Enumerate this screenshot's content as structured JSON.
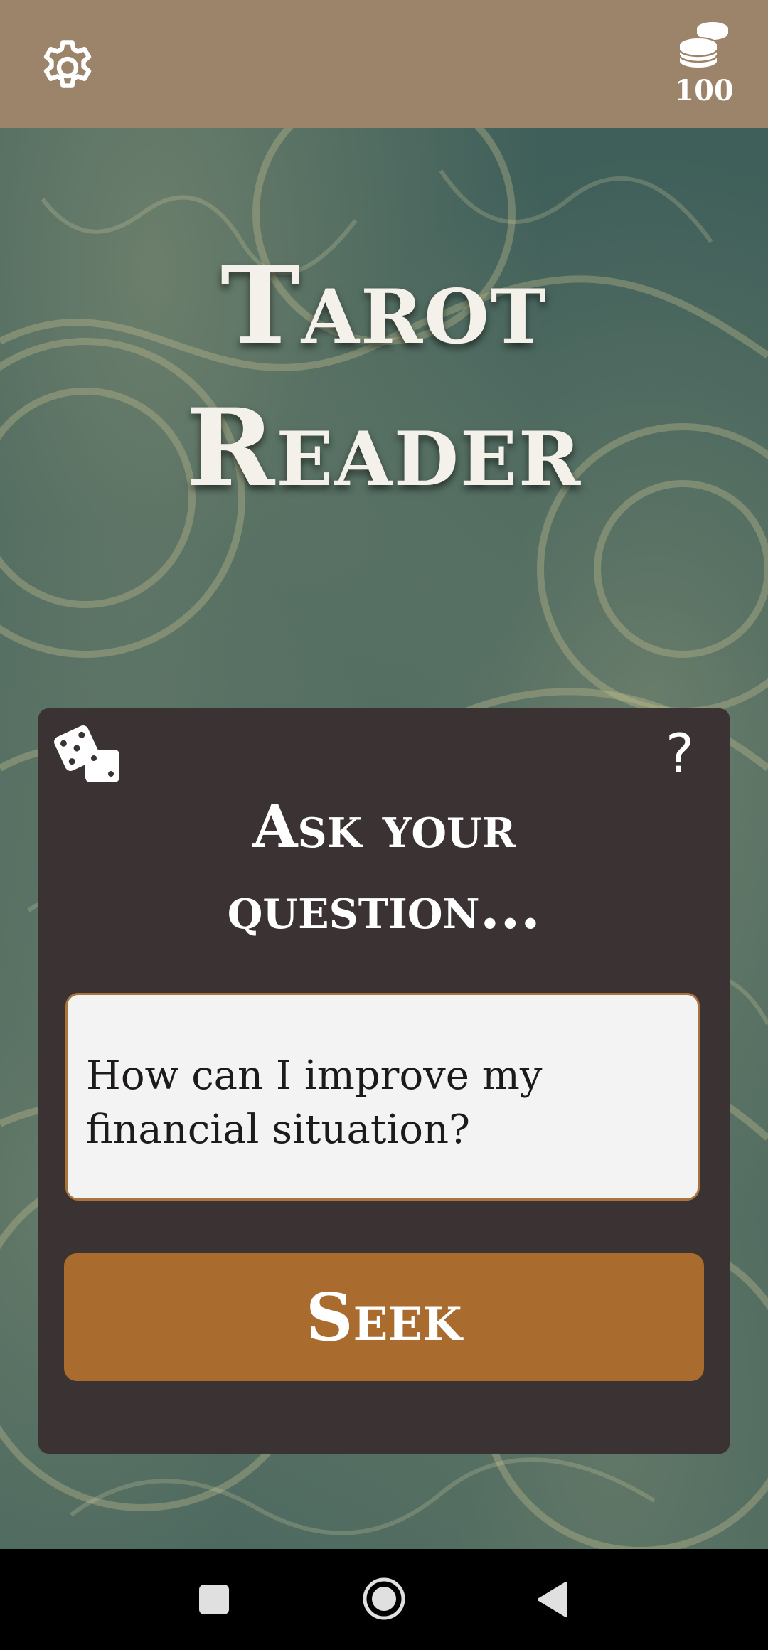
{
  "app": {
    "title_line1": "Tarot",
    "title_line2": "Reader"
  },
  "header": {
    "settings_icon": "gear-icon",
    "coins_icon": "coin-stack-icon",
    "coin_count": "100"
  },
  "question_card": {
    "dice_icon": "dice-icon",
    "help_label": "?",
    "heading_line1": "Ask your",
    "heading_line2": "question...",
    "question_value": "How can I improve my financial situation?",
    "button_label": "Seek"
  },
  "nav": {
    "recent_icon": "square-icon",
    "home_icon": "circle-icon",
    "back_icon": "triangle-back-icon"
  },
  "colors": {
    "top_bar": "#9b8469",
    "card_bg": "#3b3233",
    "button": "#a96b2e",
    "input_border": "#a8743b",
    "background": "#3f5f5a"
  }
}
